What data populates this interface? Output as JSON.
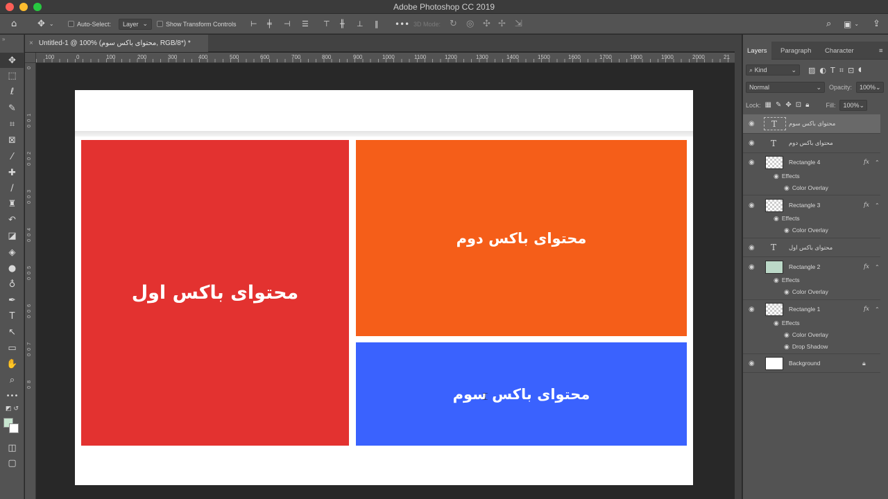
{
  "app": {
    "title": "Adobe Photoshop CC 2019"
  },
  "options_bar": {
    "auto_select_label": "Auto-Select:",
    "auto_select_value": "Layer",
    "show_transform_label": "Show Transform Controls",
    "mode_3d_label": "3D Mode:"
  },
  "document": {
    "tab_title": "Untitled-1 @ 100% (محتوای باکس سوم, RGB/8*) *",
    "close_glyph": "×"
  },
  "ruler": {
    "h_labels": [
      "100",
      "0",
      "100",
      "200",
      "300",
      "400",
      "500",
      "600",
      "700",
      "800",
      "900",
      "1000",
      "1100",
      "1200",
      "1300",
      "1400",
      "1500",
      "1600",
      "1700",
      "1800",
      "1900",
      "2000",
      "21"
    ],
    "v_labels": [
      "0",
      "1",
      "0",
      "0",
      "2",
      "0",
      "0",
      "3",
      "0",
      "0",
      "4",
      "0",
      "0",
      "5",
      "0",
      "0",
      "6",
      "0",
      "0",
      "7",
      "0",
      "0",
      "8",
      "0"
    ]
  },
  "canvas": {
    "boxes": [
      {
        "text": "محتوای باکس اول",
        "color": "#e33230"
      },
      {
        "text": "محتوای باکس دوم",
        "color": "#f55e19"
      },
      {
        "text": "محتوای باکس سوم",
        "color": "#3a62fe"
      }
    ]
  },
  "panels": {
    "tabs": [
      "Layers",
      "Paragraph",
      "Character"
    ],
    "filter_kind": "Kind",
    "blend_mode": "Normal",
    "opacity_label": "Opacity:",
    "opacity_value": "100%",
    "lock_label": "Lock:",
    "fill_label": "Fill:",
    "fill_value": "100%"
  },
  "layers": [
    {
      "name": "محتوای باکس سوم",
      "kind": "text"
    },
    {
      "name": "محتوای باکس دوم",
      "kind": "text"
    },
    {
      "name": "Rectangle 4",
      "kind": "shape",
      "fx": "fx",
      "effects_label": "Effects",
      "effects": [
        "Color Overlay"
      ]
    },
    {
      "name": "Rectangle 3",
      "kind": "shape",
      "fx": "fx",
      "effects_label": "Effects",
      "effects": [
        "Color Overlay"
      ]
    },
    {
      "name": "محتوای باکس اول",
      "kind": "text"
    },
    {
      "name": "Rectangle 2",
      "kind": "shape",
      "fx": "fx",
      "effects_label": "Effects",
      "effects": [
        "Color Overlay"
      ]
    },
    {
      "name": "Rectangle 1",
      "kind": "shape",
      "fx": "fx",
      "effects_label": "Effects",
      "effects": [
        "Color Overlay",
        "Drop Shadow"
      ]
    },
    {
      "name": "Background",
      "kind": "background"
    }
  ]
}
